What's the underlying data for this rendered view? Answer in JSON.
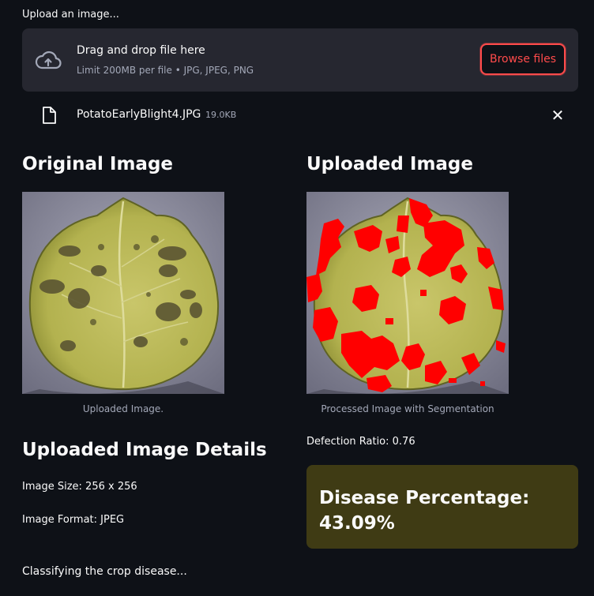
{
  "uploader": {
    "label": "Upload an image...",
    "dropzone_title": "Drag and drop file here",
    "dropzone_subtitle": "Limit 200MB per file • JPG, JPEG, PNG",
    "browse_label": "Browse files",
    "icon": "cloud-upload-icon"
  },
  "file": {
    "name": "PotatoEarlyBlight4.JPG",
    "size": "19.0KB",
    "icon": "file-icon",
    "remove_icon": "close-icon"
  },
  "original": {
    "heading": "Original Image",
    "caption": "Uploaded Image."
  },
  "uploaded": {
    "heading": "Uploaded Image",
    "caption": "Processed Image with Segmentation"
  },
  "defection_ratio": "Defection Ratio: 0.76",
  "details": {
    "heading": "Uploaded Image Details",
    "size": "Image Size: 256 x 256",
    "format": "Image Format: JPEG"
  },
  "disease_percentage": {
    "label": "Disease Percentage:",
    "value": "43.09%"
  },
  "status": "Classifying the crop disease...",
  "colors": {
    "background": "#0e1117",
    "accent": "#ff4b4b",
    "dropzone": "#262730",
    "highlight_box": "#3f3b14",
    "segmentation": "#ff0000"
  }
}
